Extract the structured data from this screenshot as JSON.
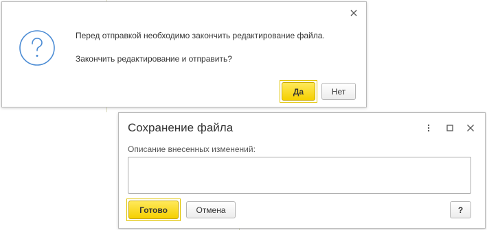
{
  "confirm_dialog": {
    "message_line1": "Перед отправкой необходимо закончить редактирование файла.",
    "message_line2": "Закончить редактирование и отправить?",
    "icon": "question-circle-icon",
    "close_icon": "close-icon",
    "yes_label": "Да",
    "no_label": "Нет"
  },
  "save_dialog": {
    "title": "Сохранение файла",
    "more_icon": "more-vertical-icon",
    "maximize_icon": "maximize-icon",
    "close_icon": "close-icon",
    "description_label": "Описание внесенных изменений:",
    "description_value": "",
    "done_label": "Готово",
    "cancel_label": "Отмена",
    "help_label": "?"
  },
  "colors": {
    "accent_button": "#f5d000",
    "icon_blue": "#4a8bd4",
    "text": "#333333"
  }
}
